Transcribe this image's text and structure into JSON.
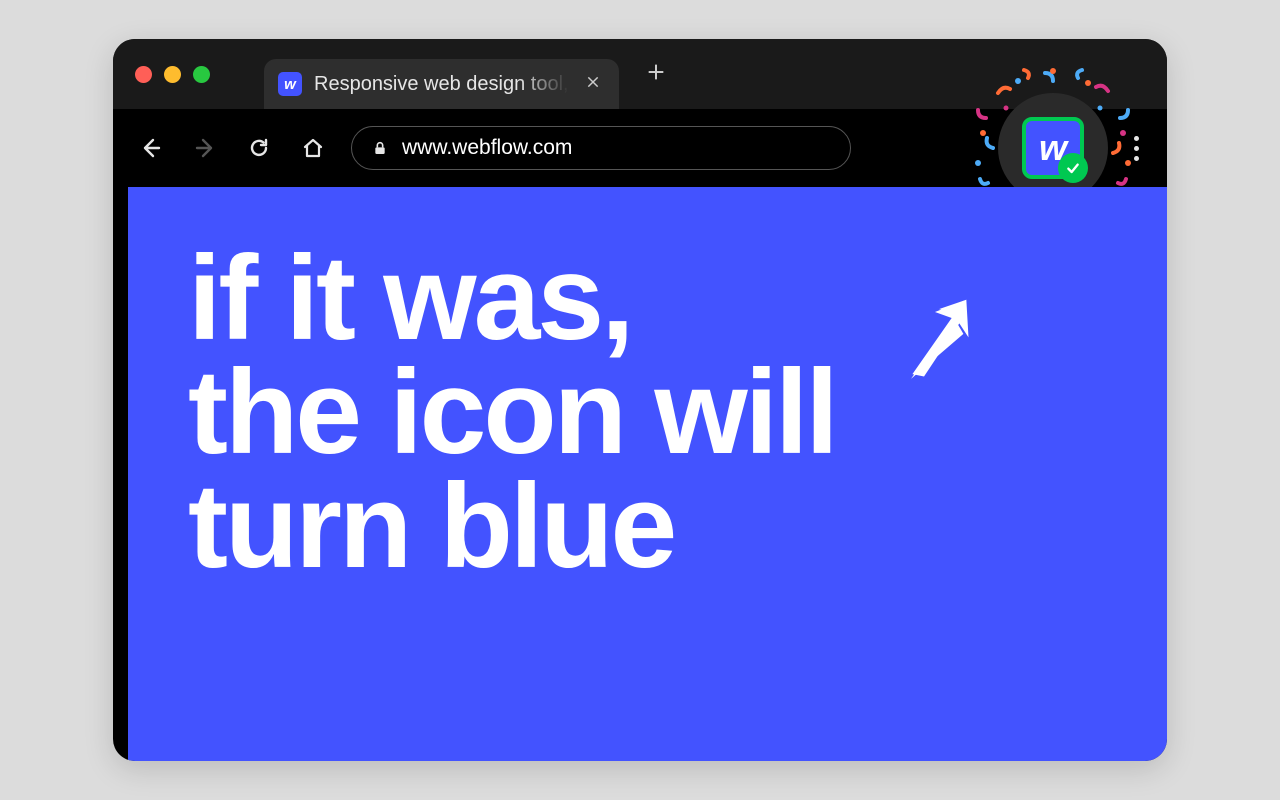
{
  "tab": {
    "title": "Responsive web design tool, C",
    "favicon_letter": "w"
  },
  "address_bar": {
    "url": "www.webflow.com"
  },
  "extension": {
    "letter": "w"
  },
  "content": {
    "headline": "if it was,\nthe icon will\nturn blue"
  }
}
